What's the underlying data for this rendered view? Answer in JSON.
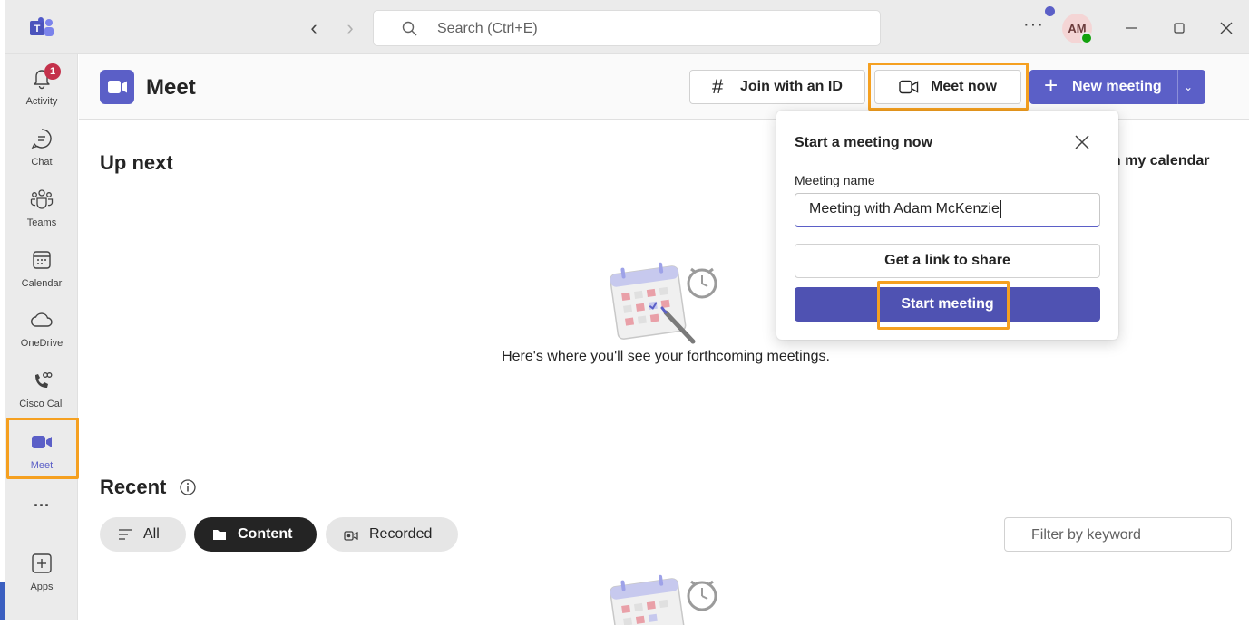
{
  "titlebar": {
    "search_placeholder": "Search (Ctrl+E)",
    "more_label": "···",
    "avatar_initials": "AM"
  },
  "rail": {
    "items": [
      {
        "label": "Activity",
        "icon": "bell-icon",
        "badge": "1"
      },
      {
        "label": "Chat",
        "icon": "chat-icon"
      },
      {
        "label": "Teams",
        "icon": "teams-icon"
      },
      {
        "label": "Calendar",
        "icon": "calendar-icon"
      },
      {
        "label": "OneDrive",
        "icon": "cloud-icon"
      },
      {
        "label": "Cisco Call",
        "icon": "phone-icon"
      },
      {
        "label": "Meet",
        "icon": "video-camera-icon",
        "active": true
      },
      {
        "label": "···",
        "icon": "more-icon"
      },
      {
        "label": "Apps",
        "icon": "add-apps-icon"
      }
    ]
  },
  "header": {
    "title": "Meet",
    "join_label": "Join with an ID",
    "meet_now_label": "Meet now",
    "new_meeting_label": "New meeting"
  },
  "upnext": {
    "title": "Up next",
    "open_calendar": "en my calendar",
    "empty_text": "Here's where you'll see your forthcoming meetings."
  },
  "recent": {
    "title": "Recent",
    "filters": [
      "All",
      "Content",
      "Recorded"
    ],
    "filter_placeholder": "Filter by keyword"
  },
  "popup": {
    "title": "Start a meeting now",
    "name_label": "Meeting name",
    "name_value": "Meeting with Adam McKenzie",
    "link_button": "Get a link to share",
    "start_button": "Start meeting"
  },
  "colors": {
    "brand": "#5b5fc7",
    "highlight": "#f5a020",
    "badge": "#c4314b",
    "presence": "#13a10e"
  }
}
